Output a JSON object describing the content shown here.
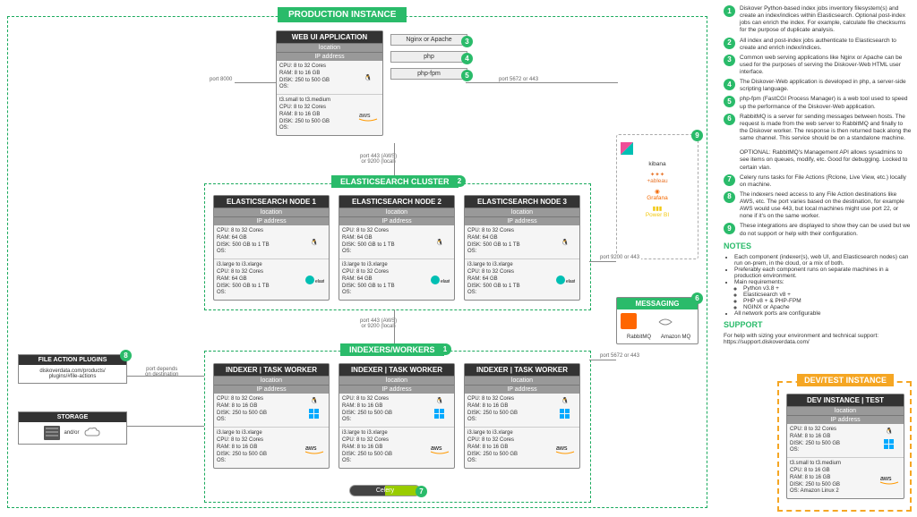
{
  "titles": {
    "prod": "PRODUCTION INSTANCE",
    "es": "ELASTICSEARCH CLUSTER",
    "idx": "INDEXERS/WORKERS",
    "dev": "DEV/TEST INSTANCE"
  },
  "webui": {
    "head": "WEB UI APPLICATION",
    "loc": "location",
    "ip": "IP address",
    "spec1": "CPU: 8 to 32 Cores\nRAM: 8 to 16 GB\nDISK: 250 to 500 GB\nOS:",
    "spec2": "t3.small to t3.medium\nCPU: 8 to 32 Cores\nRAM: 8 to 16 GB\nDISK: 250 to 500 GB\nOS:"
  },
  "pills": {
    "nginx": "Nginx or Apache",
    "php": "php",
    "phpfpm": "php-fpm"
  },
  "es_node": {
    "loc": "location",
    "ip": "IP address",
    "spec1": "CPU: 8 to 32 Cores\nRAM: 64 GB\nDISK: 500 GB to 1 TB\nOS:",
    "spec2": "i3.large to i3.xlarge\nCPU: 8 to 32 Cores\nRAM: 64 GB\nDISK: 500 GB to 1 TB\nOS:"
  },
  "es_names": [
    "ELASTICSEARCH NODE 1",
    "ELASTICSEARCH NODE 2",
    "ELASTICSEARCH NODE 3"
  ],
  "indexer": {
    "head": "INDEXER | TASK WORKER",
    "loc": "location",
    "ip": "IP address",
    "spec1": "CPU: 8 to 32 Cores\nRAM: 8 to 16 GB\nDISK: 250 to 500 GB\nOS:",
    "spec2": "i3.large to i3.xlarge\nCPU: 8 to 32 Cores\nRAM: 8 to 16 GB\nDISK: 250 to 500 GB\nOS:"
  },
  "msg": {
    "title": "MESSAGING",
    "rabbit": "RabbitMQ",
    "amq": "Amazon MQ"
  },
  "fap": {
    "title": "FILE ACTION PLUGINS",
    "link": "diskoverdata.com/products/\nplugins/#file-actions"
  },
  "storage": {
    "title": "STORAGE",
    "andor": "and/or"
  },
  "celery": "Celery",
  "analytics": {
    "kibana": "kibana",
    "tableau": "+ableau",
    "grafana": "Grafana",
    "powerbi": "Power BI"
  },
  "ports": {
    "p8000": "port 8000",
    "p5672": "port 5672 or 443",
    "p443a": "port 443 (AWS)\nor 9200 (local)",
    "p443b": "port 443 (AWS)\nor 9200 (local)",
    "p9200": "port 9200 or 443",
    "pdep": "port depends\non destination"
  },
  "dev": {
    "head": "DEV INSTANCE | TEST",
    "loc": "location",
    "ip": "IP address",
    "spec1": "CPU: 8 to 32 Cores\nRAM: 8 to 16 GB\nDISK: 250 to 500 GB\nOS:",
    "spec2": "t3.small to t3.medium\nCPU: 8 to 16 GB\nRAM: 8 to 16 GB\nDISK: 250 to 500 GB\nOS: Amazon Linux 2"
  },
  "legend": [
    "Diskover Python-based index jobs inventory filesystem(s) and create an index/indices within Elasticsearch. Optional post-index jobs can enrich the index. For example, calculate file checksums for the purpose of duplicate analysis.",
    "All index and post-index jobs authenticate to Elasticsearch to create and enrich index/indices.",
    "Common web serving applications like Nginx or Apache can be used for the purposes of serving the Diskover-Web HTML user interface.",
    "The Diskover-Web application is developed in php, a server-side scripting language.",
    "php-fpm (FastCGI Process Manager) is a web tool used to speed up the performance of the Diskover-Web application.",
    "RabbitMQ is a server for sending messages between hosts. The request is made from the web server to RabbitMQ and finally to the Diskover worker. The response is then returned back along the same channel. This service should be on a standalone machine.\n\nOPTIONAL: RabbitMQ's Management API allows sysadmins to see items on queues, modify, etc. Good for debugging. Locked to certain vlan.",
    "Celery runs tasks for File Actions (Rclone, Live View, etc.) locally on machine.",
    "The indexers need access to any File Action destinations like AWS, etc. The port varies based on the destination, for example AWS would use 443, but local machines might use port 22, or none if it's on the same worker.",
    "These integrations are displayed to show they can be used but we do not support or help with their configuration."
  ],
  "notes": {
    "title": "NOTES",
    "b1": "Each component (indexer(s), web UI, and Elasticsearch nodes) can run on-prem, in the cloud, or a mix of both.",
    "b2": "Preferably each component runs on separate machines in a production environment.",
    "b3": "Main requirements:",
    "r1": "Python v3.8 +",
    "r2": "Elasticsearch v8 +",
    "r3": "PHP v8 + & PHP-FPM",
    "r4": "NGINX or Apache",
    "b4": "All network ports are configurable"
  },
  "support": {
    "title": "SUPPORT",
    "text": "For help with sizing your environment and technical support: https://support.diskoverdata.com/"
  }
}
